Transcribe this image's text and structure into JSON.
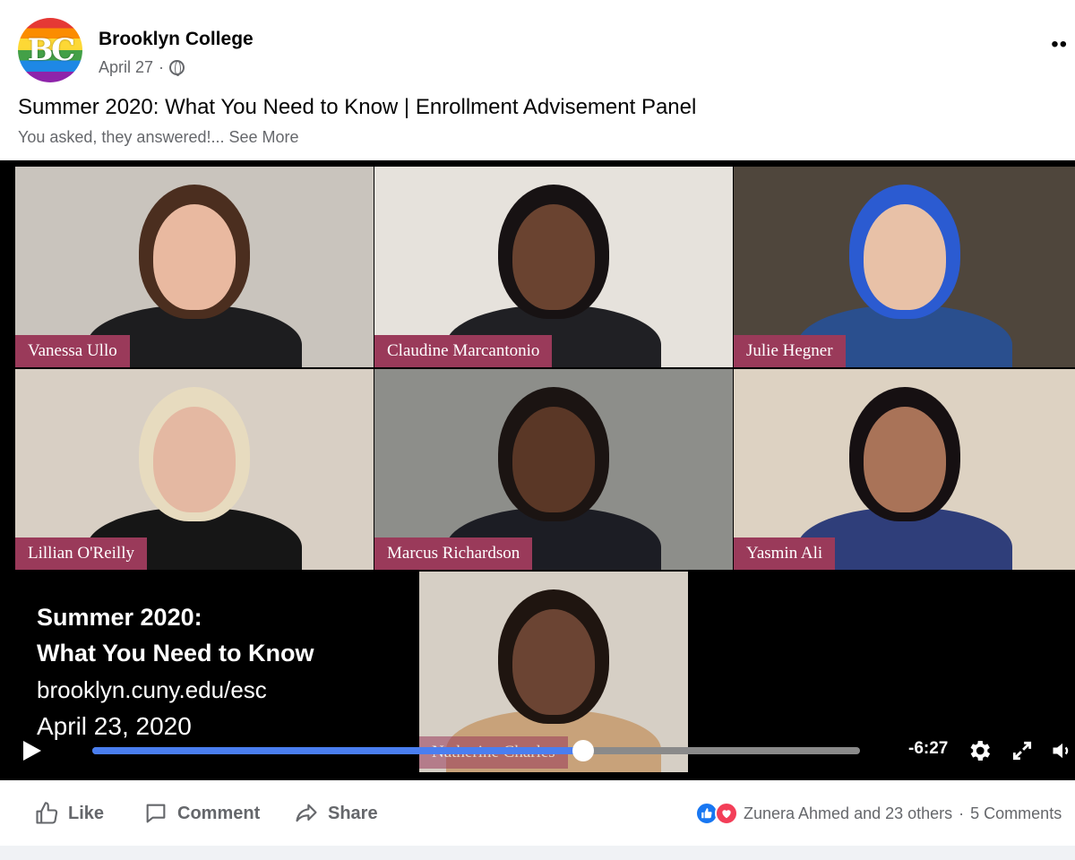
{
  "post": {
    "page_name": "Brooklyn College",
    "avatar_text": "BC",
    "date": "April 27",
    "separator": "·",
    "title": "Summer 2020: What You Need to Know | Enrollment Advisement Panel",
    "subtitle": "You asked, they answered!...",
    "see_more": "See More",
    "more_icon": "••"
  },
  "video": {
    "participants": [
      {
        "name": "Vanessa Ullo",
        "bg": "#c9c4bd",
        "skin": "#e9b9a0",
        "hair": "#4b2e1f",
        "clothes": "#1d1d1f"
      },
      {
        "name": "Claudine Marcantonio",
        "bg": "#e6e2dc",
        "skin": "#6a4330",
        "hair": "#171213",
        "clothes": "#202024"
      },
      {
        "name": "Julie Hegner",
        "bg": "#4f463c",
        "skin": "#e8c1a7",
        "hair": "#2b5bd1",
        "clothes": "#2a4f8e"
      },
      {
        "name": "Lillian O'Reilly",
        "bg": "#d8cfc4",
        "skin": "#e4b8a2",
        "hair": "#e7dbbf",
        "clothes": "#161616"
      },
      {
        "name": "Marcus Richardson",
        "bg": "#8d8e8a",
        "skin": "#5a3726",
        "hair": "#1b1412",
        "clothes": "#1c1d24"
      },
      {
        "name": "Yasmin Ali",
        "bg": "#ddd2c2",
        "skin": "#a97358",
        "hair": "#161012",
        "clothes": "#2f3e7a"
      },
      {
        "name": "Natherine Charles",
        "bg": "#d6cfc5",
        "skin": "#6b4433",
        "hair": "#1f1510",
        "clothes": "#c8a27a"
      }
    ],
    "slide": {
      "line1": "Summer 2020:",
      "line2": "What You Need to Know",
      "line3": "brooklyn.cuny.edu/esc",
      "line4": "April 23, 2020"
    },
    "remaining_time": "-6:27",
    "progress": 0.64
  },
  "actions": {
    "like": "Like",
    "comment": "Comment",
    "share": "Share"
  },
  "reactions": {
    "summary": "Zunera Ahmed and 23 others",
    "separator": "·",
    "comments": "5 Comments"
  },
  "colors": {
    "like_blue": "#1877f2",
    "love_red": "#f33e58",
    "nametag": "#9a3a5a",
    "progress": "#4a7ef0"
  }
}
